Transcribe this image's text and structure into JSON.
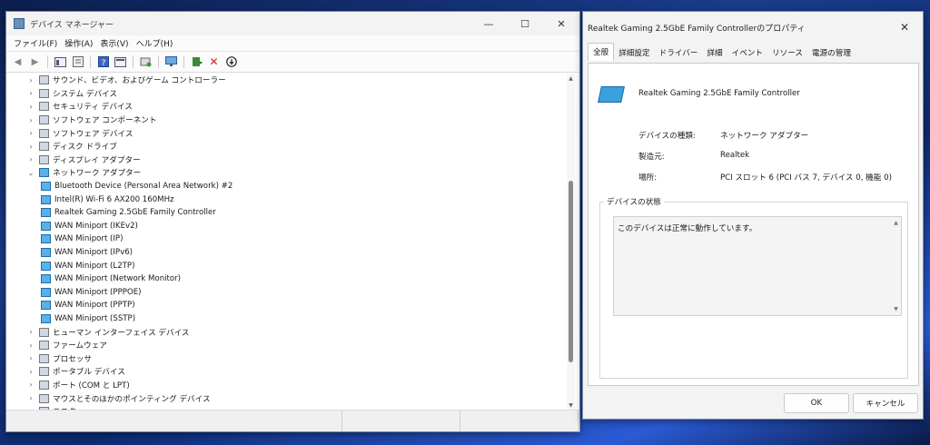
{
  "device_manager": {
    "title": "デバイス マネージャー",
    "caption": {
      "minimize": "—",
      "maximize": "☐",
      "close": "✕"
    },
    "menu": [
      "ファイル(F)",
      "操作(A)",
      "表示(V)",
      "ヘルプ(H)"
    ],
    "toolbar_icons": [
      "back-icon",
      "forward-icon",
      "show-hide-icon",
      "properties-icon",
      "help-icon",
      "view-icon",
      "scan-icon",
      "monitor-icon",
      "update-driver-icon",
      "uninstall-icon",
      "disable-icon"
    ],
    "tree": [
      {
        "label": "サウンド、ビデオ、およびゲーム コントローラー",
        "expanded": false,
        "icon": "speaker-icon"
      },
      {
        "label": "システム デバイス",
        "expanded": false,
        "icon": "system-icon"
      },
      {
        "label": "セキュリティ デバイス",
        "expanded": false,
        "icon": "security-icon"
      },
      {
        "label": "ソフトウェア コンポーネント",
        "expanded": false,
        "icon": "component-icon"
      },
      {
        "label": "ソフトウェア デバイス",
        "expanded": false,
        "icon": "software-icon"
      },
      {
        "label": "ディスク ドライブ",
        "expanded": false,
        "icon": "disk-icon"
      },
      {
        "label": "ディスプレイ アダプター",
        "expanded": false,
        "icon": "display-icon"
      },
      {
        "label": "ネットワーク アダプター",
        "expanded": true,
        "icon": "network-icon"
      },
      {
        "label": "Bluetooth Device (Personal Area Network) #2",
        "child": true
      },
      {
        "label": "Intel(R) Wi-Fi 6 AX200 160MHz",
        "child": true
      },
      {
        "label": "Realtek Gaming 2.5GbE Family Controller",
        "child": true
      },
      {
        "label": "WAN Miniport (IKEv2)",
        "child": true
      },
      {
        "label": "WAN Miniport (IP)",
        "child": true
      },
      {
        "label": "WAN Miniport (IPv6)",
        "child": true
      },
      {
        "label": "WAN Miniport (L2TP)",
        "child": true
      },
      {
        "label": "WAN Miniport (Network Monitor)",
        "child": true
      },
      {
        "label": "WAN Miniport (PPPOE)",
        "child": true
      },
      {
        "label": "WAN Miniport (PPTP)",
        "child": true
      },
      {
        "label": "WAN Miniport (SSTP)",
        "child": true
      },
      {
        "label": "ヒューマン インターフェイス デバイス",
        "expanded": false,
        "icon": "hid-icon"
      },
      {
        "label": "ファームウェア",
        "expanded": false,
        "icon": "firmware-icon"
      },
      {
        "label": "プロセッサ",
        "expanded": false,
        "icon": "processor-icon"
      },
      {
        "label": "ポータブル デバイス",
        "expanded": false,
        "icon": "portable-icon"
      },
      {
        "label": "ポート (COM と LPT)",
        "expanded": false,
        "icon": "port-icon"
      },
      {
        "label": "マウスとそのほかのポインティング デバイス",
        "expanded": false,
        "icon": "mouse-icon"
      },
      {
        "label": "モニター",
        "expanded": false,
        "icon": "monitor-icon"
      }
    ]
  },
  "properties": {
    "title": "Realtek Gaming 2.5GbE Family Controllerのプロパティ",
    "close": "✕",
    "tabs": [
      "全般",
      "詳細設定",
      "ドライバー",
      "詳細",
      "イベント",
      "リソース",
      "電源の管理"
    ],
    "active_tab": 0,
    "device_name": "Realtek Gaming 2.5GbE Family Controller",
    "fields": [
      {
        "label": "デバイスの種類:",
        "value": "ネットワーク アダプター"
      },
      {
        "label": "製造元:",
        "value": "Realtek"
      },
      {
        "label": "場所:",
        "value": "PCI スロット 6 (PCI バス 7, デバイス 0, 機能 0)"
      }
    ],
    "status_group_label": "デバイスの状態",
    "status_text": "このデバイスは正常に動作しています。",
    "ok_label": "OK",
    "cancel_label": "キャンセル"
  }
}
